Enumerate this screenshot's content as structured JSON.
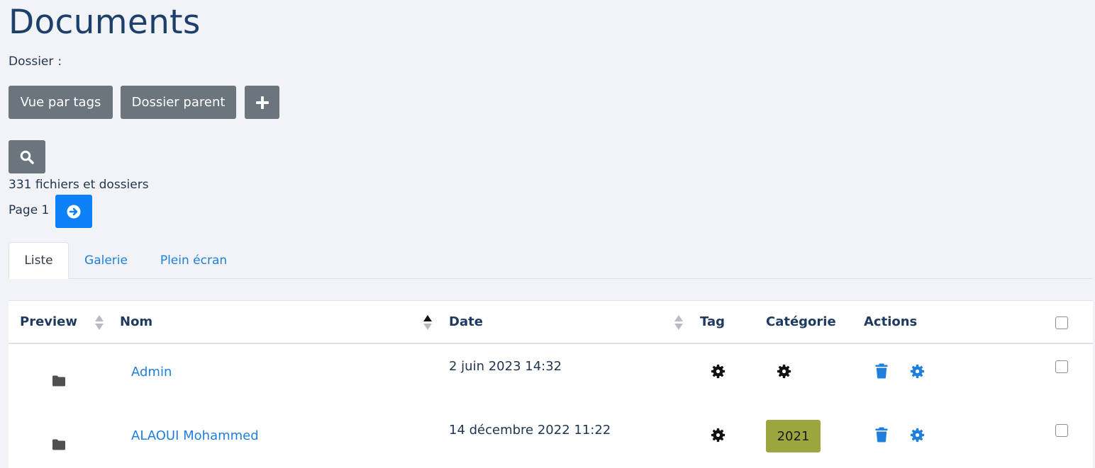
{
  "header": {
    "title": "Documents",
    "folder_label": "Dossier",
    "folder_separator": ":"
  },
  "toolbar": {
    "tags_view_label": "Vue par tags",
    "parent_folder_label": "Dossier parent",
    "add_icon": "plus-icon",
    "search_icon": "search-icon"
  },
  "summary": {
    "count_text": "331 fichiers et dossiers",
    "page_text": "Page 1",
    "next_icon": "arrow-circle-right-icon"
  },
  "tabs": [
    {
      "label": "Liste",
      "active": true
    },
    {
      "label": "Galerie",
      "active": false
    },
    {
      "label": "Plein écran",
      "active": false
    }
  ],
  "table": {
    "columns": {
      "preview": "Preview",
      "name": "Nom",
      "date": "Date",
      "tag": "Tag",
      "category": "Catégorie",
      "actions": "Actions"
    },
    "sort": {
      "column": "Nom",
      "direction": "asc"
    },
    "rows": [
      {
        "icon": "folder-icon",
        "name": "Admin",
        "date": "2 juin 2023 14:32",
        "tag_icon": "gear-icon",
        "category": "",
        "category_icon": "gear-icon",
        "actions": [
          "trash-icon",
          "gear-icon"
        ],
        "checked": false
      },
      {
        "icon": "folder-icon",
        "name": "ALAOUI Mohammed",
        "date": "14 décembre 2022 11:22",
        "tag_icon": "gear-icon",
        "category": "2021",
        "actions": [
          "trash-icon",
          "gear-icon"
        ],
        "checked": false
      }
    ]
  },
  "colors": {
    "background": "#f1f3f7",
    "title": "#1c3f6b",
    "button_grey": "#6c757d",
    "button_blue": "#0d7ff7",
    "link": "#1e7fdc",
    "badge": "#9ba63e"
  }
}
